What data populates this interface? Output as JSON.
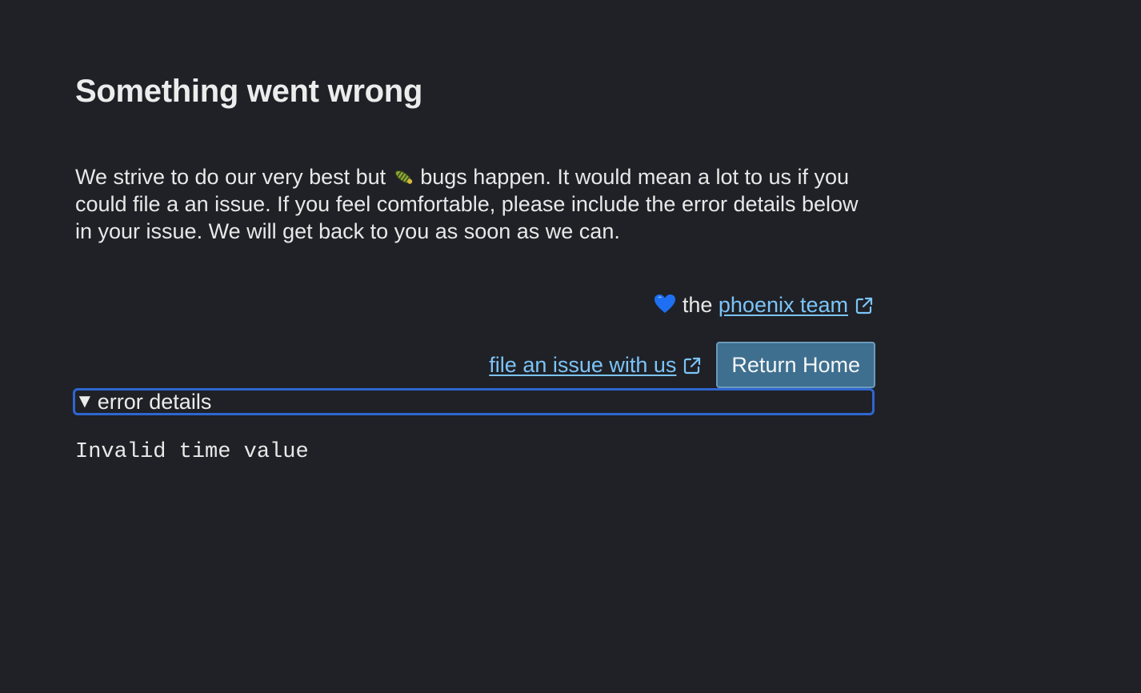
{
  "error_page": {
    "title": "Something went wrong",
    "message_before_icon": "We strive to do our very best but",
    "message_after_icon": "bugs happen. It would mean a lot to us if you could file a an issue. If you feel comfortable, please include the error details below in your issue. We will get back to you as soon as we can.",
    "signature_prefix": "the",
    "team_link_label": "phoenix team",
    "file_issue_label": "file an issue with us",
    "return_button_label": "Return Home",
    "details_caret": "▼",
    "details_label": "error details",
    "error_message": "Invalid time value"
  },
  "icons": {
    "bug": "bug-icon",
    "heart": "blue-heart-icon",
    "external_link": "external-link-icon"
  },
  "colors": {
    "background": "#1f2126",
    "text": "#e8e8e8",
    "link": "#7cc4f8",
    "button_bg": "#3f6f8f",
    "button_border": "#6b9bbd",
    "focus_ring": "#2f66d0",
    "heart": "#1f6ff2"
  }
}
